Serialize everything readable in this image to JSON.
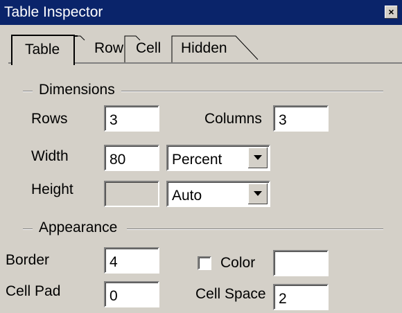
{
  "window": {
    "title": "Table Inspector",
    "close_label": "×"
  },
  "tabs": [
    "Table",
    "Row",
    "Cell",
    "Hidden"
  ],
  "dimensions": {
    "legend": "Dimensions",
    "rows_label": "Rows",
    "rows_value": "3",
    "columns_label": "Columns",
    "columns_value": "3",
    "width_label": "Width",
    "width_value": "80",
    "width_unit": "Percent",
    "height_label": "Height",
    "height_value": "",
    "height_unit": "Auto"
  },
  "appearance": {
    "legend": "Appearance",
    "border_label": "Border",
    "border_value": "4",
    "color_label": "Color",
    "color_value": "",
    "color_checked": false,
    "cellpad_label": "Cell Pad",
    "cellpad_value": "0",
    "cellspace_label": "Cell Space",
    "cellspace_value": "2"
  }
}
